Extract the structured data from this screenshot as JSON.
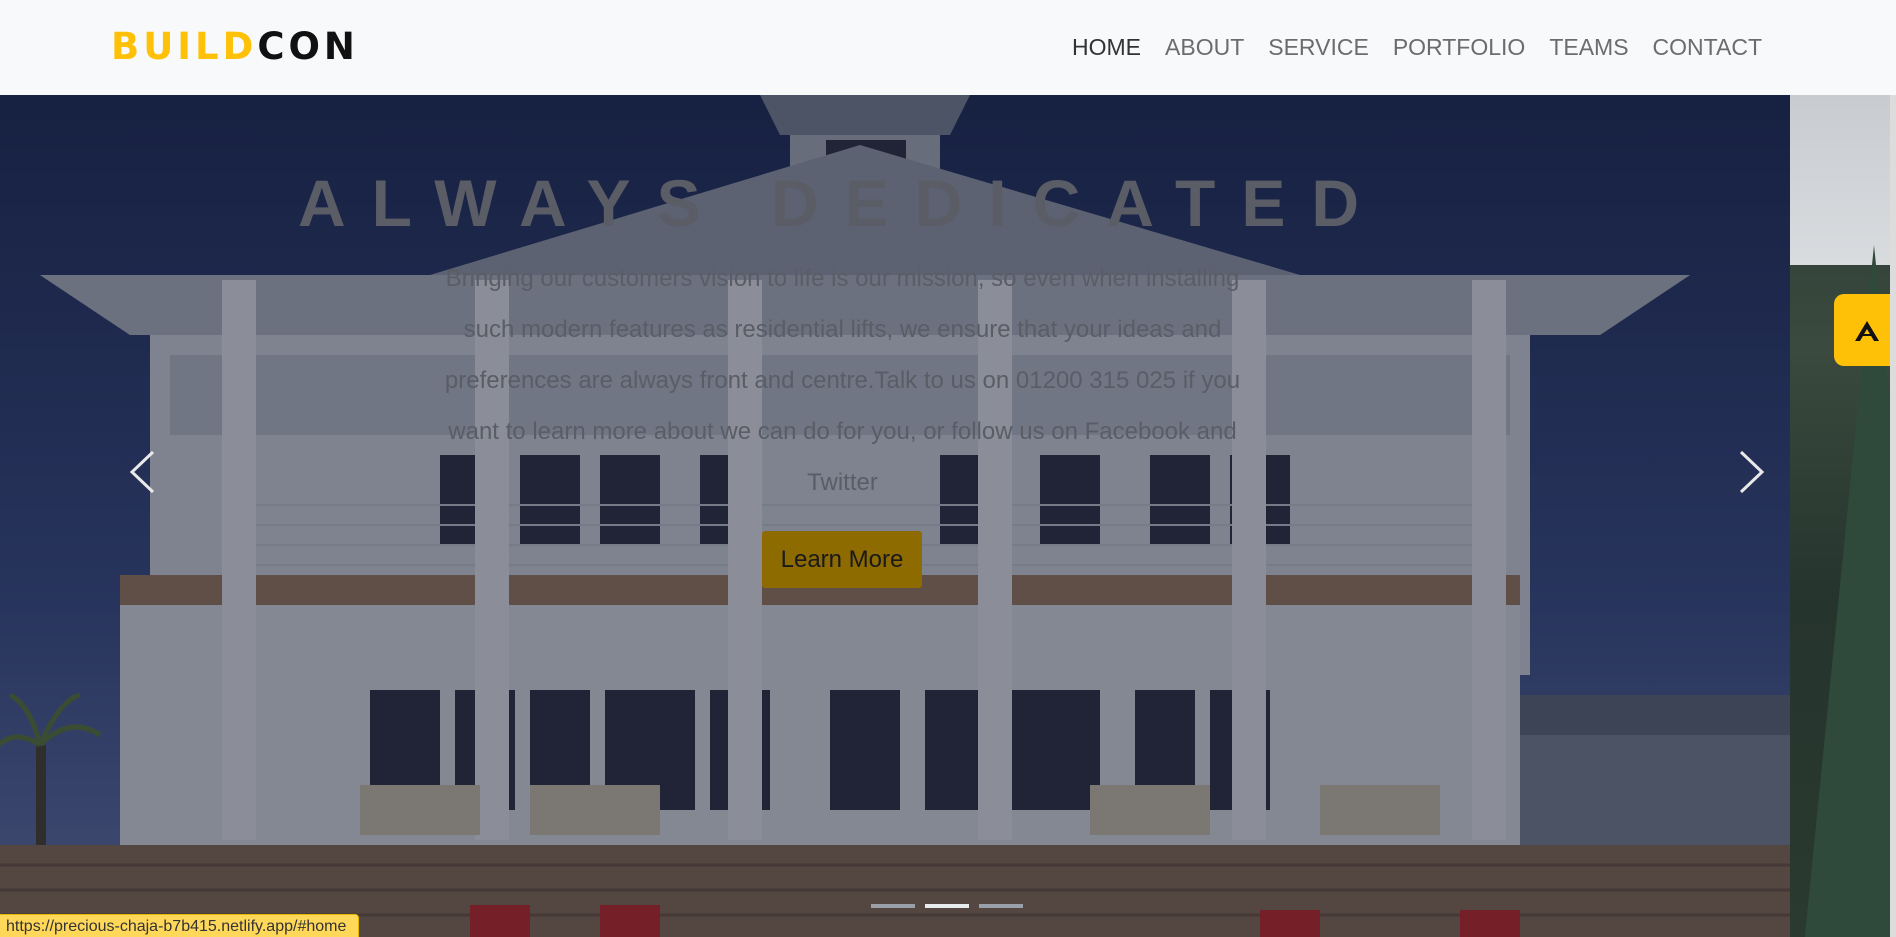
{
  "brand": {
    "part1": "BUILD",
    "part2": "CON"
  },
  "nav": {
    "items": [
      {
        "label": "HOME",
        "active": true
      },
      {
        "label": "ABOUT",
        "active": false
      },
      {
        "label": "SERVICE",
        "active": false
      },
      {
        "label": "PORTFOLIO",
        "active": false
      },
      {
        "label": "TEAMS",
        "active": false
      },
      {
        "label": "CONTACT",
        "active": false
      }
    ]
  },
  "hero": {
    "title": "ALWAYS DEDICATED",
    "text": "Bringing our customers vision to life is our mission, so even when installing such modern features as residential lifts, we ensure that your ideas and preferences are always front and centre.Talk to us on 01200 315 025 if you want to learn more about we can do for you, or follow us on Facebook and Twitter",
    "button_label": "Learn More",
    "prev_icon": "chevron-left-icon",
    "next_icon": "chevron-right-icon",
    "indicators": {
      "count": 3,
      "active_index": 1
    }
  },
  "fab_icon": "brand-logo-icon",
  "status_url": "https://precious-chaja-b7b415.netlify.app/#home",
  "colors": {
    "accent": "#ffc107",
    "dark": "#111111",
    "nav_text": "#6c6c6c"
  }
}
